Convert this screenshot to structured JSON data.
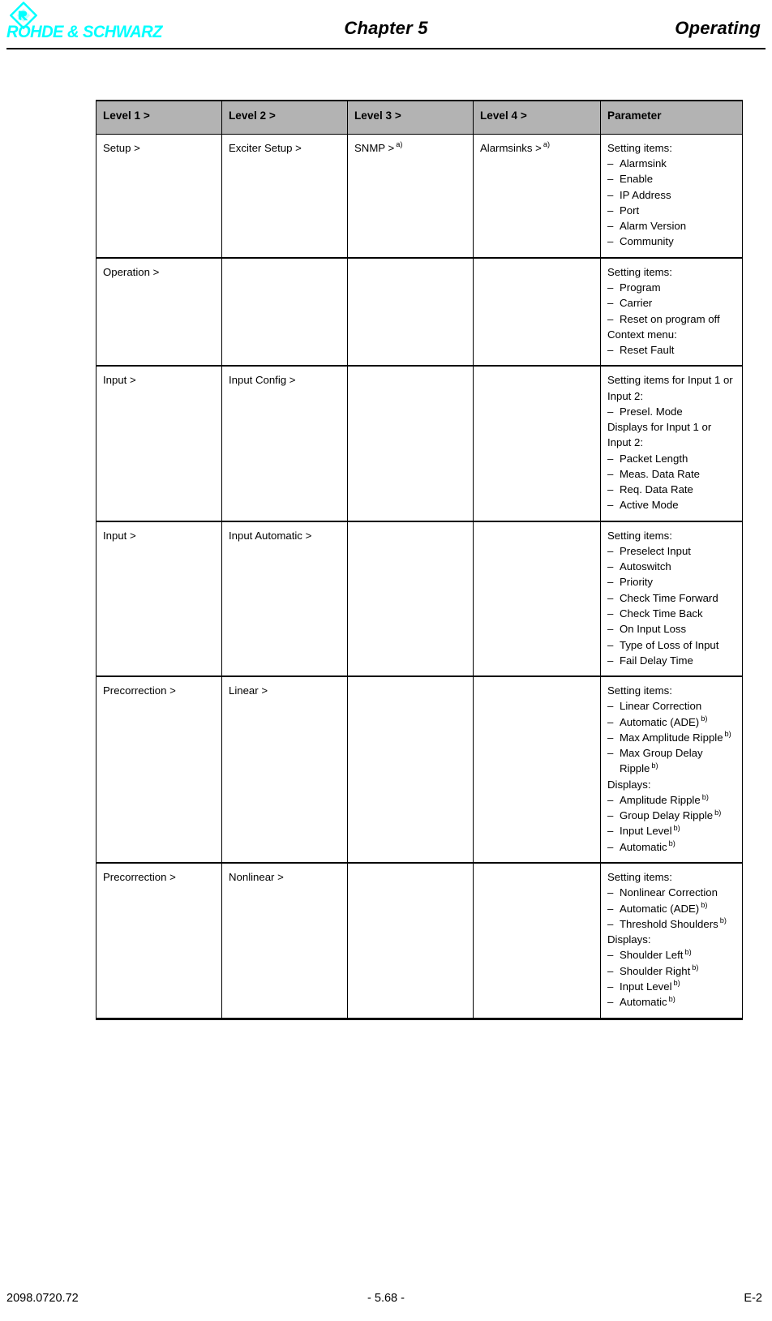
{
  "header": {
    "brand": "ROHDE & SCHWARZ",
    "logo_icon": "rohde-schwarz-diamond-logo",
    "chapter": "Chapter 5",
    "section": "Operating",
    "brand_color": "#00ffff"
  },
  "table": {
    "columns": [
      "Level 1 >",
      "Level 2 >",
      "Level 3 >",
      "Level 4 >",
      "Parameter"
    ],
    "rows": [
      {
        "level1": "Setup >",
        "level2": "Exciter Setup >",
        "level3": "SNMP >",
        "level3_marker": "a)",
        "level4": "Alarmsinks >",
        "level4_marker": "a)",
        "parameter": [
          {
            "type": "plain",
            "text": "Setting items:"
          },
          {
            "type": "dash",
            "text": "Alarmsink"
          },
          {
            "type": "dash",
            "text": "Enable"
          },
          {
            "type": "dash",
            "text": "IP Address"
          },
          {
            "type": "dash",
            "text": "Port"
          },
          {
            "type": "dash",
            "text": "Alarm Version"
          },
          {
            "type": "dash",
            "text": "Community"
          }
        ]
      },
      {
        "level1": "Operation >",
        "level2": "",
        "level3": "",
        "level4": "",
        "parameter": [
          {
            "type": "plain",
            "text": "Setting items:"
          },
          {
            "type": "dash",
            "text": "Program"
          },
          {
            "type": "dash",
            "text": "Carrier"
          },
          {
            "type": "dash",
            "text": "Reset on program off"
          },
          {
            "type": "plain",
            "text": "Context menu:"
          },
          {
            "type": "dash",
            "text": "Reset Fault"
          }
        ]
      },
      {
        "level1": "Input >",
        "level2": "Input Config >",
        "level3": "",
        "level4": "",
        "parameter": [
          {
            "type": "plain",
            "text": "Setting items for Input 1 or Input 2:"
          },
          {
            "type": "dash",
            "text": "Presel. Mode"
          },
          {
            "type": "plain",
            "text": "Displays for Input 1 or Input 2:"
          },
          {
            "type": "dash",
            "text": "Packet Length"
          },
          {
            "type": "dash",
            "text": "Meas. Data Rate"
          },
          {
            "type": "dash",
            "text": "Req. Data Rate"
          },
          {
            "type": "dash",
            "text": "Active Mode"
          }
        ]
      },
      {
        "level1": "Input >",
        "level2": "Input Automatic >",
        "level3": "",
        "level4": "",
        "parameter": [
          {
            "type": "plain",
            "text": "Setting items:"
          },
          {
            "type": "dash",
            "text": "Preselect Input"
          },
          {
            "type": "dash",
            "text": "Autoswitch"
          },
          {
            "type": "dash",
            "text": "Priority"
          },
          {
            "type": "dash",
            "text": "Check Time Forward"
          },
          {
            "type": "dash",
            "text": "Check Time Back"
          },
          {
            "type": "dash",
            "text": "On Input Loss"
          },
          {
            "type": "dash",
            "text": "Type of Loss of Input"
          },
          {
            "type": "dash",
            "text": "Fail Delay Time"
          }
        ]
      },
      {
        "level1": "Precorrection >",
        "level2": "Linear >",
        "level3": "",
        "level4": "",
        "parameter": [
          {
            "type": "plain",
            "text": "Setting items:"
          },
          {
            "type": "dash",
            "text": "Linear Correction"
          },
          {
            "type": "dash",
            "text": "Automatic (ADE)",
            "marker": "b)"
          },
          {
            "type": "dash",
            "text": "Max Amplitude Ripple",
            "marker": "b)"
          },
          {
            "type": "dash",
            "text": "Max Group Delay Ripple",
            "marker": "b)"
          },
          {
            "type": "plain",
            "text": "Displays:"
          },
          {
            "type": "dash",
            "text": "Amplitude Ripple",
            "marker": "b)"
          },
          {
            "type": "dash",
            "text": "Group Delay Ripple",
            "marker": "b)"
          },
          {
            "type": "dash",
            "text": "Input Level",
            "marker": "b)"
          },
          {
            "type": "dash",
            "text": "Automatic",
            "marker": "b)"
          }
        ]
      },
      {
        "level1": "Precorrection >",
        "level2": "Nonlinear >",
        "level3": "",
        "level4": "",
        "parameter": [
          {
            "type": "plain",
            "text": "Setting items:"
          },
          {
            "type": "dash",
            "text": "Nonlinear Correction"
          },
          {
            "type": "dash",
            "text": "Automatic (ADE)",
            "marker": "b)"
          },
          {
            "type": "dash",
            "text": "Threshold Shoulders",
            "marker": "b)"
          },
          {
            "type": "plain",
            "text": "Displays:"
          },
          {
            "type": "dash",
            "text": "Shoulder Left",
            "marker": "b)"
          },
          {
            "type": "dash",
            "text": "Shoulder Right",
            "marker": "b)"
          },
          {
            "type": "dash",
            "text": "Input Level",
            "marker": "b)"
          },
          {
            "type": "dash",
            "text": "Automatic",
            "marker": "b)"
          }
        ]
      }
    ]
  },
  "footer": {
    "document_number": "2098.0720.72",
    "page_number": "- 5.68 -",
    "edition": "E-2"
  }
}
